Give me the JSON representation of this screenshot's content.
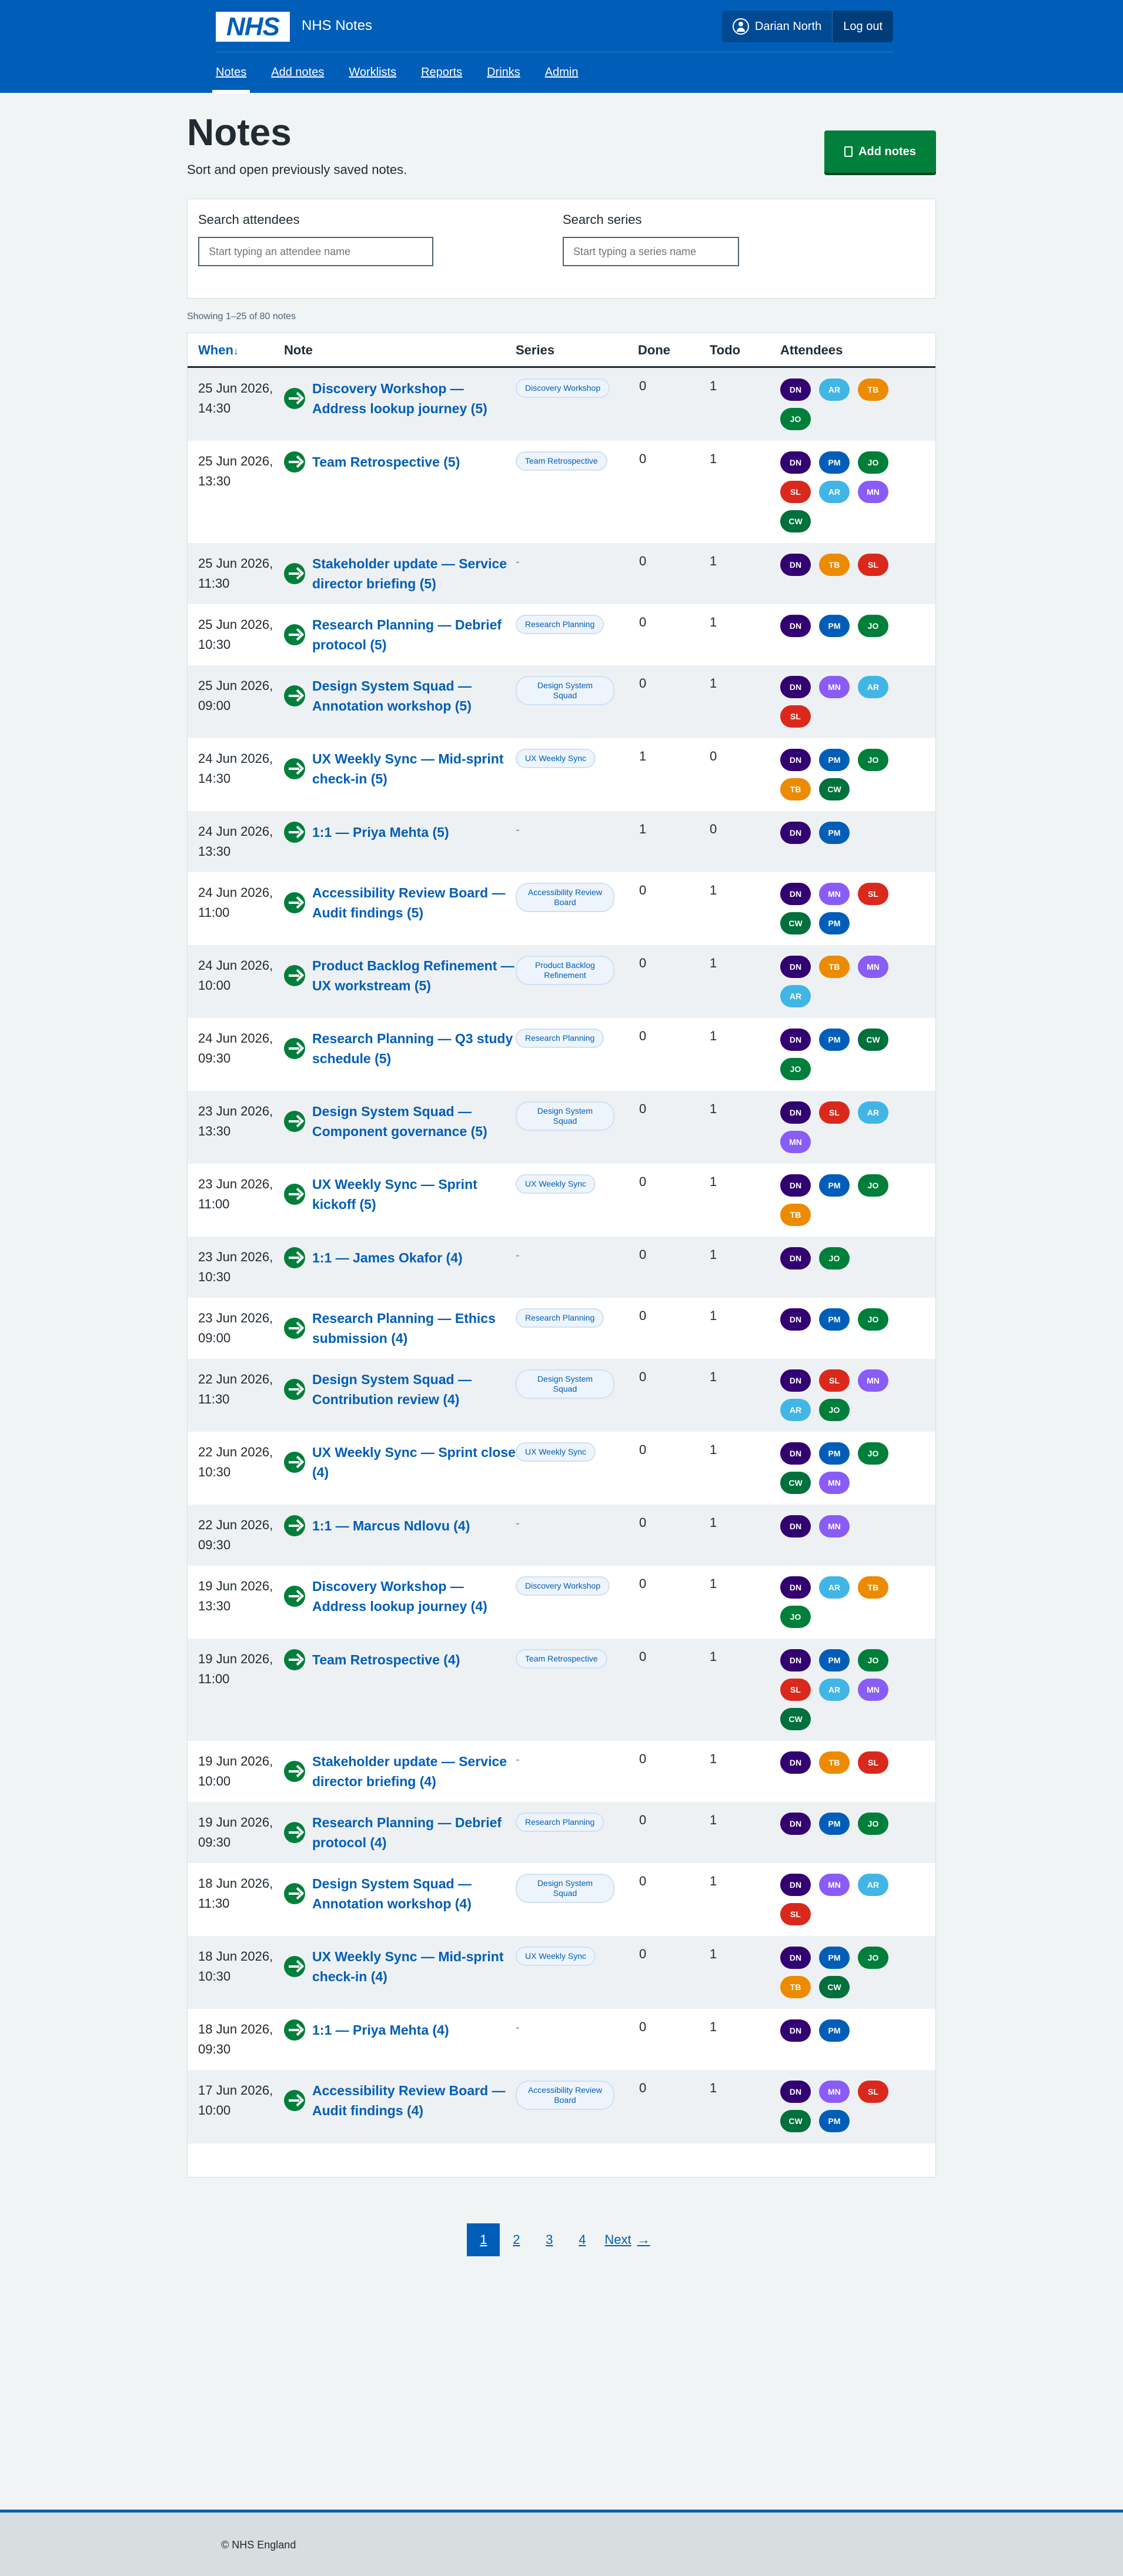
{
  "header": {
    "logo": "NHS",
    "service_name": "NHS Notes",
    "user_name": "Darian North",
    "logout_label": "Log out",
    "nav": [
      {
        "label": "Notes",
        "active": true
      },
      {
        "label": "Add notes",
        "active": false
      },
      {
        "label": "Worklists",
        "active": false
      },
      {
        "label": "Reports",
        "active": false
      },
      {
        "label": "Drinks",
        "active": false
      },
      {
        "label": "Admin",
        "active": false
      }
    ]
  },
  "page": {
    "title": "Notes",
    "subtitle": "Sort and open previously saved notes.",
    "add_button_label": "Add notes"
  },
  "search": {
    "attendees_label": "Search attendees",
    "attendees_placeholder": "Start typing an attendee name",
    "series_label": "Search series",
    "series_placeholder": "Start typing a series name"
  },
  "results_count": "Showing 1–25 of 80 notes",
  "table": {
    "headers": {
      "when": "When",
      "note": "Note",
      "series": "Series",
      "done": "Done",
      "todo": "Todo",
      "attendees": "Attendees"
    },
    "sort_indicator": "↓",
    "rows": [
      {
        "when": "25 Jun 2026, 14:30",
        "note": "Discovery Workshop — Address lookup journey (5)",
        "series": "Discovery Workshop",
        "done": "0",
        "todo": "1",
        "attendees": [
          "DN",
          "AR",
          "TB",
          "JO"
        ]
      },
      {
        "when": "25 Jun 2026, 13:30",
        "note": "Team Retrospective (5)",
        "series": "Team Retrospective",
        "done": "0",
        "todo": "1",
        "attendees": [
          "DN",
          "PM",
          "JO",
          "SL",
          "AR",
          "MN",
          "CW"
        ]
      },
      {
        "when": "25 Jun 2026, 11:30",
        "note": "Stakeholder update — Service director briefing (5)",
        "series": "-",
        "done": "0",
        "todo": "1",
        "attendees": [
          "DN",
          "TB",
          "SL"
        ]
      },
      {
        "when": "25 Jun 2026, 10:30",
        "note": "Research Planning — Debrief protocol (5)",
        "series": "Research Planning",
        "done": "0",
        "todo": "1",
        "attendees": [
          "DN",
          "PM",
          "JO"
        ]
      },
      {
        "when": "25 Jun 2026, 09:00",
        "note": "Design System Squad — Annotation workshop (5)",
        "series": "Design System Squad",
        "done": "0",
        "todo": "1",
        "attendees": [
          "DN",
          "MN",
          "AR",
          "SL"
        ]
      },
      {
        "when": "24 Jun 2026, 14:30",
        "note": "UX Weekly Sync — Mid-sprint check-in (5)",
        "series": "UX Weekly Sync",
        "done": "1",
        "todo": "0",
        "attendees": [
          "DN",
          "PM",
          "JO",
          "TB",
          "CW"
        ]
      },
      {
        "when": "24 Jun 2026, 13:30",
        "note": "1:1 — Priya Mehta (5)",
        "series": "-",
        "done": "1",
        "todo": "0",
        "attendees": [
          "DN",
          "PM"
        ]
      },
      {
        "when": "24 Jun 2026, 11:00",
        "note": "Accessibility Review Board — Audit findings (5)",
        "series": "Accessibility Review Board",
        "done": "0",
        "todo": "1",
        "attendees": [
          "DN",
          "MN",
          "SL",
          "CW",
          "PM"
        ]
      },
      {
        "when": "24 Jun 2026, 10:00",
        "note": "Product Backlog Refinement — UX workstream (5)",
        "series": "Product Backlog Refinement",
        "done": "0",
        "todo": "1",
        "attendees": [
          "DN",
          "TB",
          "MN",
          "AR"
        ]
      },
      {
        "when": "24 Jun 2026, 09:30",
        "note": "Research Planning — Q3 study schedule (5)",
        "series": "Research Planning",
        "done": "0",
        "todo": "1",
        "attendees": [
          "DN",
          "PM",
          "CW",
          "JO"
        ]
      },
      {
        "when": "23 Jun 2026, 13:30",
        "note": "Design System Squad — Component governance (5)",
        "series": "Design System Squad",
        "done": "0",
        "todo": "1",
        "attendees": [
          "DN",
          "SL",
          "AR",
          "MN"
        ]
      },
      {
        "when": "23 Jun 2026, 11:00",
        "note": "UX Weekly Sync — Sprint kickoff (5)",
        "series": "UX Weekly Sync",
        "done": "0",
        "todo": "1",
        "attendees": [
          "DN",
          "PM",
          "JO",
          "TB"
        ]
      },
      {
        "when": "23 Jun 2026, 10:30",
        "note": "1:1 — James Okafor (4)",
        "series": "-",
        "done": "0",
        "todo": "1",
        "attendees": [
          "DN",
          "JO"
        ]
      },
      {
        "when": "23 Jun 2026, 09:00",
        "note": "Research Planning — Ethics submission (4)",
        "series": "Research Planning",
        "done": "0",
        "todo": "1",
        "attendees": [
          "DN",
          "PM",
          "JO"
        ]
      },
      {
        "when": "22 Jun 2026, 11:30",
        "note": "Design System Squad — Contribution review (4)",
        "series": "Design System Squad",
        "done": "0",
        "todo": "1",
        "attendees": [
          "DN",
          "SL",
          "MN",
          "AR",
          "JO"
        ]
      },
      {
        "when": "22 Jun 2026, 10:30",
        "note": "UX Weekly Sync — Sprint close (4)",
        "series": "UX Weekly Sync",
        "done": "0",
        "todo": "1",
        "attendees": [
          "DN",
          "PM",
          "JO",
          "CW",
          "MN"
        ]
      },
      {
        "when": "22 Jun 2026, 09:30",
        "note": "1:1 — Marcus Ndlovu (4)",
        "series": "-",
        "done": "0",
        "todo": "1",
        "attendees": [
          "DN",
          "MN"
        ]
      },
      {
        "when": "19 Jun 2026, 13:30",
        "note": "Discovery Workshop — Address lookup journey (4)",
        "series": "Discovery Workshop",
        "done": "0",
        "todo": "1",
        "attendees": [
          "DN",
          "AR",
          "TB",
          "JO"
        ]
      },
      {
        "when": "19 Jun 2026, 11:00",
        "note": "Team Retrospective (4)",
        "series": "Team Retrospective",
        "done": "0",
        "todo": "1",
        "attendees": [
          "DN",
          "PM",
          "JO",
          "SL",
          "AR",
          "MN",
          "CW"
        ]
      },
      {
        "when": "19 Jun 2026, 10:00",
        "note": "Stakeholder update — Service director briefing (4)",
        "series": "-",
        "done": "0",
        "todo": "1",
        "attendees": [
          "DN",
          "TB",
          "SL"
        ]
      },
      {
        "when": "19 Jun 2026, 09:30",
        "note": "Research Planning — Debrief protocol (4)",
        "series": "Research Planning",
        "done": "0",
        "todo": "1",
        "attendees": [
          "DN",
          "PM",
          "JO"
        ]
      },
      {
        "when": "18 Jun 2026, 11:30",
        "note": "Design System Squad — Annotation workshop (4)",
        "series": "Design System Squad",
        "done": "0",
        "todo": "1",
        "attendees": [
          "DN",
          "MN",
          "AR",
          "SL"
        ]
      },
      {
        "when": "18 Jun 2026, 10:30",
        "note": "UX Weekly Sync — Mid-sprint check-in (4)",
        "series": "UX Weekly Sync",
        "done": "0",
        "todo": "1",
        "attendees": [
          "DN",
          "PM",
          "JO",
          "TB",
          "CW"
        ]
      },
      {
        "when": "18 Jun 2026, 09:30",
        "note": "1:1 — Priya Mehta (4)",
        "series": "-",
        "done": "0",
        "todo": "1",
        "attendees": [
          "DN",
          "PM"
        ]
      },
      {
        "when": "17 Jun 2026, 10:00",
        "note": "Accessibility Review Board — Audit findings (4)",
        "series": "Accessibility Review Board",
        "done": "0",
        "todo": "1",
        "attendees": [
          "DN",
          "MN",
          "SL",
          "CW",
          "PM"
        ]
      }
    ]
  },
  "pagination": {
    "pages": [
      "1",
      "2",
      "3",
      "4"
    ],
    "current": "1",
    "next_label": "Next",
    "next_arrow": "→"
  },
  "footer": {
    "copyright": "© NHS England"
  },
  "colors": {
    "brand_blue": "#005eb8",
    "button_green": "#007f3b",
    "avatar_DN": "#330072",
    "avatar_AR": "#41b6e6",
    "avatar_TB": "#ed8b00",
    "avatar_JO": "#007f3b",
    "avatar_PM": "#005eb8",
    "avatar_SL": "#da291c",
    "avatar_MN": "#8a5cf6",
    "avatar_CW": "#00703c"
  }
}
